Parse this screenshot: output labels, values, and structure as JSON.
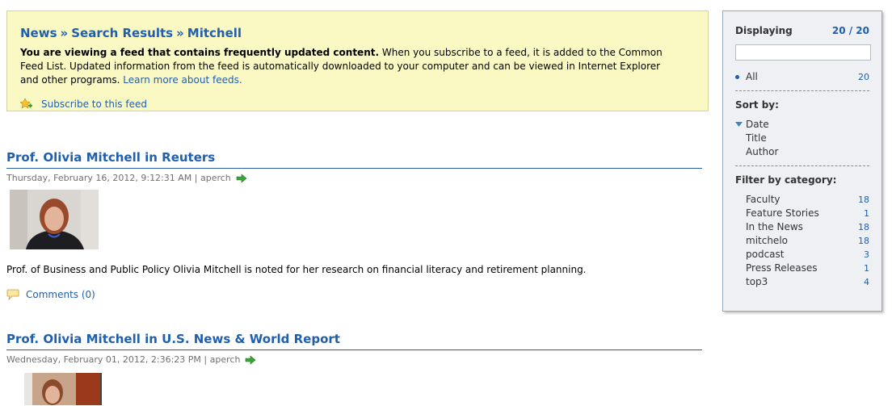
{
  "banner": {
    "breadcrumb": [
      "News",
      "Search Results",
      "Mitchell"
    ],
    "breadcrumb_sep": "»",
    "info_bold": "You are viewing a feed that contains frequently updated content.",
    "info_rest": " When you subscribe to a feed, it is added to the Common Feed List. Updated information from the feed is automatically downloaded to your computer and can be viewed in Internet Explorer and other programs.",
    "learn_more": "Learn more about feeds.",
    "subscribe_label": "Subscribe to this feed"
  },
  "articles": [
    {
      "title": "Prof. Olivia Mitchell in Reuters",
      "meta": "Thursday, February 16, 2012, 9:12:31 AM | aperch",
      "body": "Prof. of Business and Public Policy Olivia Mitchell is noted for her research on financial literacy and retirement planning.",
      "comments": "Comments (0)"
    },
    {
      "title": "Prof. Olivia Mitchell in U.S. News & World Report",
      "meta": "Wednesday, February 01, 2012, 2:36:23 PM | aperch"
    }
  ],
  "sidebar": {
    "displaying_label": "Displaying",
    "displaying_count": "20 / 20",
    "all_label": "All",
    "all_count": "20",
    "sort_label": "Sort by:",
    "sort_options": [
      "Date",
      "Title",
      "Author"
    ],
    "filter_label": "Filter by category:",
    "categories": [
      {
        "name": "Faculty",
        "count": "18"
      },
      {
        "name": "Feature Stories",
        "count": "1"
      },
      {
        "name": "In the News",
        "count": "18"
      },
      {
        "name": "mitchelo",
        "count": "18"
      },
      {
        "name": "podcast",
        "count": "3"
      },
      {
        "name": "Press Releases",
        "count": "1"
      },
      {
        "name": "top3",
        "count": "4"
      }
    ]
  },
  "icons": {
    "subscribe": "add-feed-icon",
    "arrow": "go-arrow-icon",
    "comment": "speech-bubble-icon",
    "sort": "sort-descending-icon"
  },
  "colors": {
    "link": "#1f5fad",
    "banner_bg": "#fbf9c3",
    "sidebar_bg": "#eef0f4"
  }
}
